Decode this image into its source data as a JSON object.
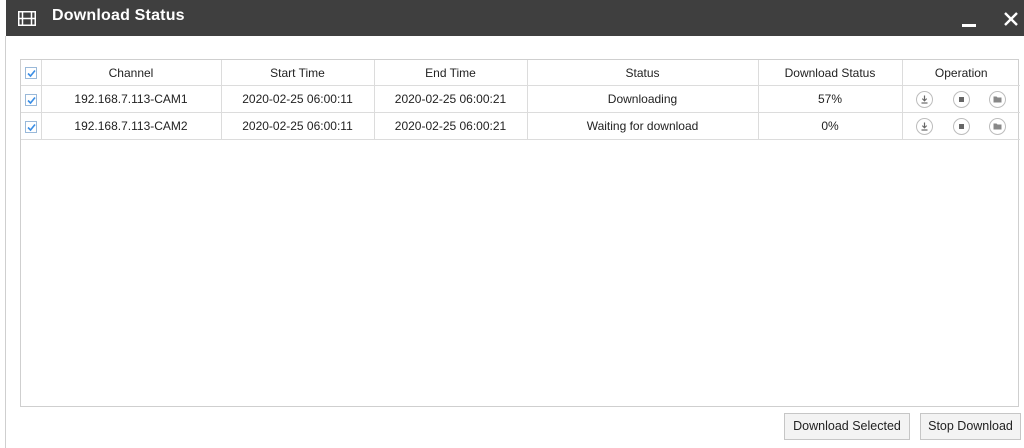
{
  "window": {
    "title": "Download Status"
  },
  "table": {
    "headers": {
      "channel": "Channel",
      "start_time": "Start Time",
      "end_time": "End Time",
      "status": "Status",
      "download_status": "Download Status",
      "operation": "Operation"
    },
    "select_all_checked": true,
    "rows": [
      {
        "checked": true,
        "channel": "192.168.7.113-CAM1",
        "start_time": "2020-02-25 06:00:11",
        "end_time": "2020-02-25 06:00:21",
        "status": "Downloading",
        "download_status": "57%"
      },
      {
        "checked": true,
        "channel": "192.168.7.113-CAM2",
        "start_time": "2020-02-25 06:00:11",
        "end_time": "2020-02-25 06:00:21",
        "status": "Waiting for download",
        "download_status": "0%"
      }
    ],
    "operation_icons": [
      "download-icon",
      "stop-icon",
      "folder-icon"
    ]
  },
  "buttons": {
    "download_selected": "Download Selected",
    "stop_download": "Stop Download"
  },
  "colors": {
    "titlebar": "#3f3f3f",
    "checkbox_check": "#3a8ee6"
  }
}
